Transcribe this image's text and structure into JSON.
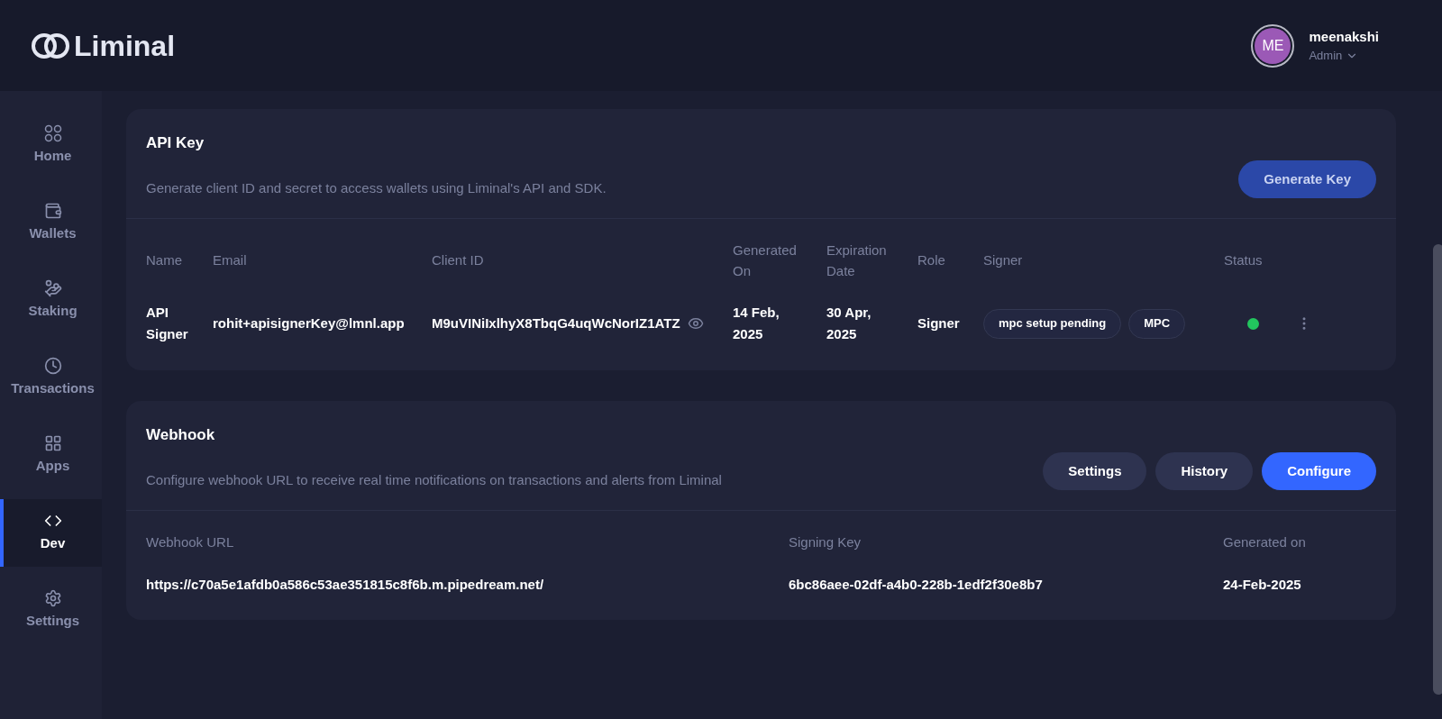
{
  "header": {
    "logo": "Liminal",
    "user": {
      "initials": "ME",
      "name": "meenakshi",
      "role": "Admin"
    }
  },
  "sidebar": {
    "items": [
      {
        "label": "Home",
        "selected": false
      },
      {
        "label": "Wallets",
        "selected": false
      },
      {
        "label": "Staking",
        "selected": false
      },
      {
        "label": "Transactions",
        "selected": false
      },
      {
        "label": "Apps",
        "selected": false
      },
      {
        "label": "Dev",
        "selected": true
      },
      {
        "label": "Settings",
        "selected": false
      }
    ]
  },
  "api_key": {
    "title": "API Key",
    "description": "Generate client ID and secret to access wallets using Liminal's API and SDK.",
    "buttons": [
      {
        "label": "Generate Key",
        "kind": "muted"
      }
    ],
    "table": {
      "columns": [
        "Name",
        "Email",
        "Client ID",
        "Generated On",
        "Expiration Date",
        "Role",
        "Signer",
        "Status"
      ],
      "rows": [
        {
          "name": "API Signer",
          "email": "rohit+apisignerKey@lmnl.app",
          "client_id": "M9uVINiIxlhyX8TbqG4uqWcNorIZ1ATZ",
          "generated_on": "14 Feb, 2025",
          "expiration_date": "30 Apr, 2025",
          "role": "Signer",
          "signer_tags": [
            "mpc setup pending",
            "MPC"
          ],
          "color": "#22c55e"
        }
      ]
    }
  },
  "webhook": {
    "title": "Webhook",
    "description": "Configure webhook URL to receive real time notifications on transactions and alerts from Liminal",
    "buttons": [
      {
        "label": "Settings",
        "kind": "secondary"
      },
      {
        "label": "History",
        "kind": "secondary"
      },
      {
        "label": "Configure",
        "kind": "primary"
      }
    ],
    "table": {
      "columns": [
        "Webhook URL",
        "Signing Key",
        "Generated on"
      ],
      "rows": [
        {
          "url": "https://c70a5e1afdb0a586c53ae351815c8f6b.m.pipedream.net/",
          "signing_key": "6bc86aee-02df-a4b0-228b-1edf2f30e8b7",
          "generated_on": "24-Feb-2025"
        }
      ]
    }
  }
}
